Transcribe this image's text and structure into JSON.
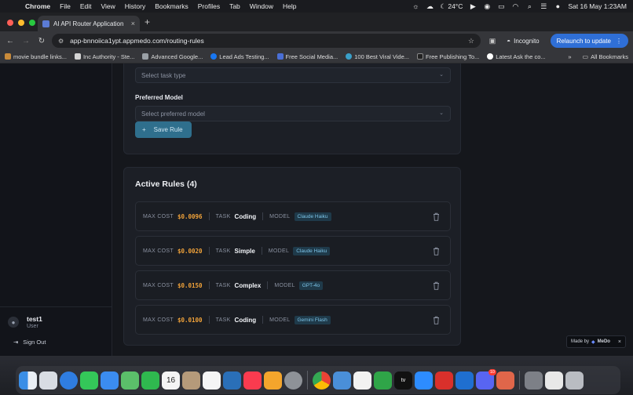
{
  "menubar": {
    "app": "Chrome",
    "items": [
      "File",
      "Edit",
      "View",
      "History",
      "Bookmarks",
      "Profiles",
      "Tab",
      "Window",
      "Help"
    ],
    "weather": "24°C",
    "clock": "Sat 16 May  1:23AM"
  },
  "browser": {
    "tab_title": "AI API Router Application",
    "url": "app-bnnoiica1ypt.appmedo.com/routing-rules",
    "incognito_label": "Incognito",
    "relaunch_label": "Relaunch to update",
    "bookmarks": [
      "movie bundle links...",
      "Inc Authority - Ste...",
      "Advanced Google...",
      "Lead Ads Testing...",
      "Free Social Media...",
      "100 Best Viral Vide...",
      "Free Publishing To...",
      "Latest Ask the co..."
    ],
    "all_bookmarks": "All Bookmarks"
  },
  "sidebar": {
    "user_name": "test1",
    "user_role": "User",
    "sign_out": "Sign Out"
  },
  "form": {
    "task_type_placeholder": "Select task type",
    "preferred_model_label": "Preferred Model",
    "preferred_model_placeholder": "Select preferred model",
    "save_label": "Save Rule"
  },
  "rules": {
    "title": "Active Rules (4)",
    "max_cost_label": "MAX COST",
    "task_label": "TASK",
    "model_label": "MODEL",
    "items": [
      {
        "cost": "$0.0096",
        "task": "Coding",
        "model": "Claude Haiku"
      },
      {
        "cost": "$0.0020",
        "task": "Simple",
        "model": "Claude Haiku"
      },
      {
        "cost": "$0.0150",
        "task": "Complex",
        "model": "GPT-4o"
      },
      {
        "cost": "$0.0100",
        "task": "Coding",
        "model": "Gemini Flash"
      }
    ]
  },
  "badge": {
    "made_by": "Made by",
    "brand": "MeDo"
  },
  "dock": {
    "calendar_day": "16",
    "mail_badge": "10"
  }
}
